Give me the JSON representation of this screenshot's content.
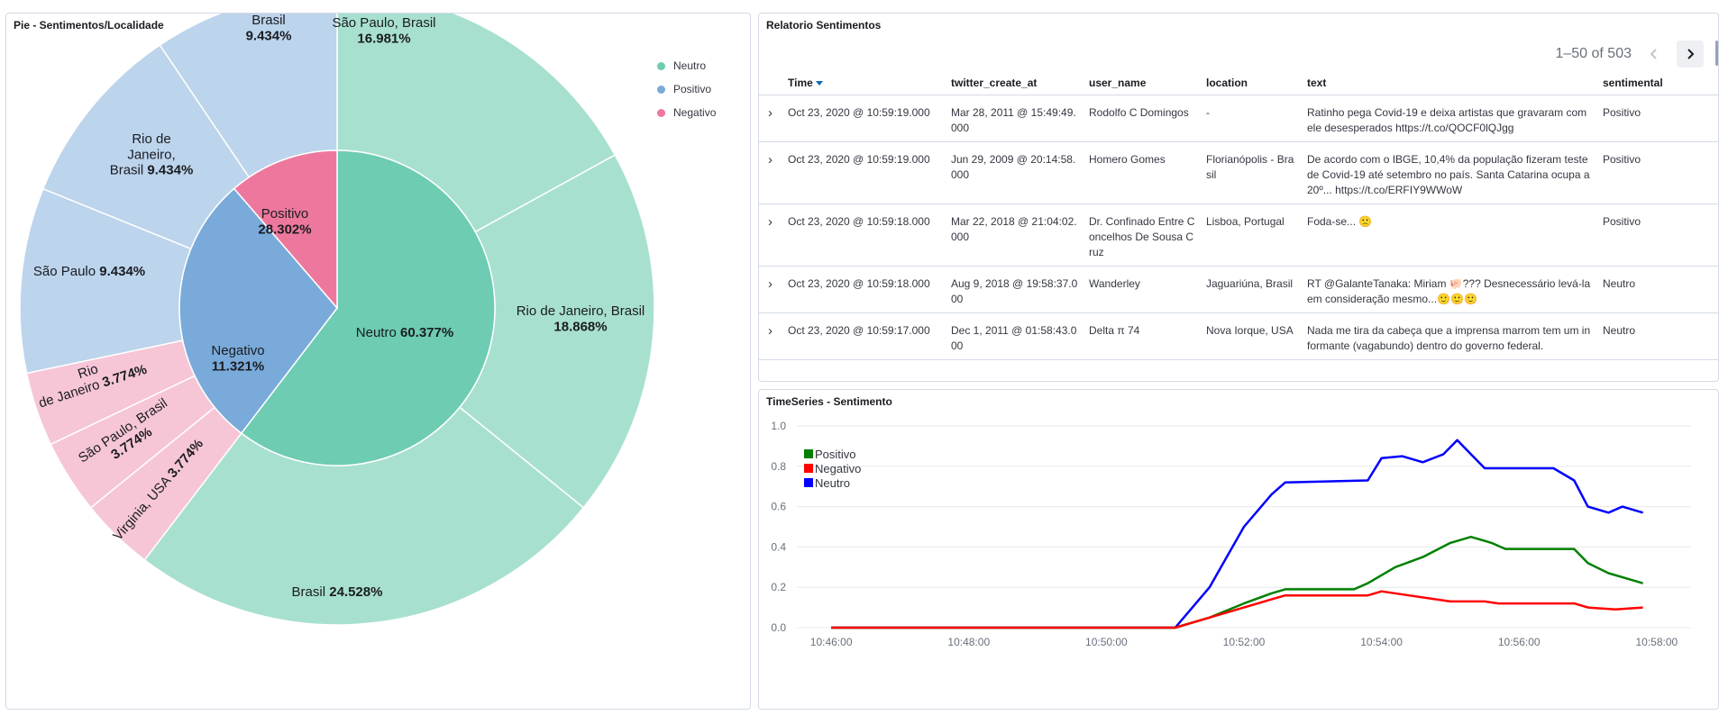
{
  "pie_panel": {
    "title": "Pie - Sentimentos/Localidade",
    "legend": [
      {
        "label": "Neutro",
        "color": "#6dccb1"
      },
      {
        "label": "Positivo",
        "color": "#79aad9"
      },
      {
        "label": "Negativo",
        "color": "#ee789d"
      }
    ]
  },
  "table_panel": {
    "title": "Relatorio Sentimentos",
    "pagination": {
      "text": "1–50 of 503",
      "prev_icon": "chevron-left-icon",
      "next_icon": "chevron-right-icon"
    },
    "columns": [
      "Time",
      "twitter_create_at",
      "user_name",
      "location",
      "text",
      "sentimental"
    ],
    "rows": [
      {
        "time": "Oct 23, 2020 @ 10:59:19.000",
        "created": "Mar 28, 2011 @ 15:49:49.000",
        "user": "Rodolfo C Domingos",
        "location": " -",
        "text": "Ratinho pega Covid-19 e deixa artistas que gravaram com ele desesperados https://t.co/QOCF0lQJgg",
        "sentimental": "Positivo"
      },
      {
        "time": "Oct 23, 2020 @ 10:59:19.000",
        "created": "Jun 29, 2009 @ 20:14:58.000",
        "user": "Homero Gomes",
        "location": "Florianópolis - Brasil",
        "text": "De acordo com o IBGE, 10,4% da população fizeram teste de Covid-19 até setembro no país. Santa Catarina ocupa a 20º... https://t.co/ERFIY9WWoW",
        "sentimental": "Positivo"
      },
      {
        "time": "Oct 23, 2020 @ 10:59:18.000",
        "created": "Mar 22, 2018 @ 21:04:02.000",
        "user": "Dr. Confinado Entre Concelhos De Sousa Cruz",
        "location": "Lisboa, Portugal",
        "text": "Foda-se... 🙁",
        "sentimental": "Positivo"
      },
      {
        "time": "Oct 23, 2020 @ 10:59:18.000",
        "created": "Aug 9, 2018 @ 19:58:37.000",
        "user": "Wanderley",
        "location": "Jaguariúna, Brasil",
        "text": "RT @GalanteTanaka: Miriam 🐖??? Desnecessário levá-la em consideração mesmo...🙂🙂🙂",
        "sentimental": "Neutro"
      },
      {
        "time": "Oct 23, 2020 @ 10:59:17.000",
        "created": "Dec 1, 2011 @ 01:58:43.000",
        "user": "Delta π 74",
        "location": "Nova Iorque, USA",
        "text": "Nada me tira da cabeça que a imprensa marrom tem um informante (vagabundo) dentro do governo federal.",
        "sentimental": "Neutro"
      }
    ]
  },
  "ts_panel": {
    "title": "TimeSeries - Sentimento",
    "legend": [
      {
        "label": "Positivo",
        "color": "#008000"
      },
      {
        "label": "Negativo",
        "color": "#ff0000"
      },
      {
        "label": "Neutro",
        "color": "#0000ff"
      }
    ]
  },
  "chart_data": [
    {
      "type": "pie",
      "title": "Pie - Sentimentos/Localidade",
      "inner_ring": [
        {
          "label": "Neutro",
          "value": 60.377,
          "display": "60.377%",
          "color": "#6dccb1"
        },
        {
          "label": "Positivo",
          "value": 28.302,
          "display": "28.302%",
          "color": "#79aad9"
        },
        {
          "label": "Negativo",
          "value": 11.321,
          "display": "11.321%",
          "color": "#ee789d"
        }
      ],
      "outer_ring": [
        {
          "parent": "Neutro",
          "label": "São Paulo, Brasil",
          "value": 16.981,
          "display": "16.981%"
        },
        {
          "parent": "Neutro",
          "label": "Rio de Janeiro, Brasil",
          "value": 18.868,
          "display": "18.868%"
        },
        {
          "parent": "Neutro",
          "label": "Brasil",
          "value": 24.528,
          "display": "24.528%"
        },
        {
          "parent": "Negativo",
          "label": "Virginia, USA",
          "value": 3.774,
          "display": "3.774%"
        },
        {
          "parent": "Negativo",
          "label": "São Paulo, Brasil",
          "value": 3.774,
          "display": "3.774%"
        },
        {
          "parent": "Negativo",
          "label": "Rio de Janeiro",
          "value": 3.774,
          "display": "3.774%"
        },
        {
          "parent": "Positivo",
          "label": "São Paulo",
          "value": 9.434,
          "display": "9.434%"
        },
        {
          "parent": "Positivo",
          "label": "Rio de Janeiro, Brasil",
          "value": 9.434,
          "display": "9.434%"
        },
        {
          "parent": "Positivo",
          "label": "Brasil",
          "value": 9.434,
          "display": "9.434%"
        }
      ],
      "outer_colors": {
        "Neutro": "#a8e0d0",
        "Positivo": "#bcd4ec",
        "Negativo": "#f6c6d6"
      }
    },
    {
      "type": "line",
      "title": "TimeSeries - Sentimento",
      "x_ticks": [
        "10:46:00",
        "10:48:00",
        "10:50:00",
        "10:52:00",
        "10:54:00",
        "10:56:00",
        "10:58:00"
      ],
      "y_ticks": [
        "0.0",
        "0.2",
        "0.4",
        "0.6",
        "0.8",
        "1.0"
      ],
      "xlim_minutes": [
        45.5,
        58.5
      ],
      "ylim": [
        0,
        1.0
      ],
      "series": [
        {
          "name": "Neutro",
          "color": "#0000ff",
          "points": [
            [
              46.0,
              0
            ],
            [
              51.0,
              0
            ],
            [
              51.2,
              0.08
            ],
            [
              51.5,
              0.2
            ],
            [
              51.8,
              0.38
            ],
            [
              52.0,
              0.5
            ],
            [
              52.2,
              0.58
            ],
            [
              52.4,
              0.66
            ],
            [
              52.6,
              0.72
            ],
            [
              53.8,
              0.73
            ],
            [
              54.0,
              0.84
            ],
            [
              54.3,
              0.85
            ],
            [
              54.6,
              0.82
            ],
            [
              54.9,
              0.86
            ],
            [
              55.1,
              0.93
            ],
            [
              55.3,
              0.86
            ],
            [
              55.5,
              0.79
            ],
            [
              56.5,
              0.79
            ],
            [
              56.8,
              0.73
            ],
            [
              57.0,
              0.6
            ],
            [
              57.3,
              0.57
            ],
            [
              57.5,
              0.6
            ],
            [
              57.8,
              0.57
            ]
          ]
        },
        {
          "name": "Positivo",
          "color": "#008000",
          "points": [
            [
              46.0,
              0
            ],
            [
              51.0,
              0
            ],
            [
              51.5,
              0.05
            ],
            [
              52.0,
              0.12
            ],
            [
              52.4,
              0.17
            ],
            [
              52.6,
              0.19
            ],
            [
              53.6,
              0.19
            ],
            [
              53.8,
              0.22
            ],
            [
              54.2,
              0.3
            ],
            [
              54.6,
              0.35
            ],
            [
              55.0,
              0.42
            ],
            [
              55.3,
              0.45
            ],
            [
              55.6,
              0.42
            ],
            [
              55.8,
              0.39
            ],
            [
              56.8,
              0.39
            ],
            [
              57.0,
              0.32
            ],
            [
              57.3,
              0.27
            ],
            [
              57.6,
              0.24
            ],
            [
              57.8,
              0.22
            ]
          ]
        },
        {
          "name": "Negativo",
          "color": "#ff0000",
          "points": [
            [
              46.0,
              0
            ],
            [
              51.0,
              0
            ],
            [
              51.5,
              0.05
            ],
            [
              52.0,
              0.1
            ],
            [
              52.4,
              0.14
            ],
            [
              52.6,
              0.16
            ],
            [
              53.8,
              0.16
            ],
            [
              54.0,
              0.18
            ],
            [
              54.4,
              0.16
            ],
            [
              55.0,
              0.13
            ],
            [
              55.5,
              0.13
            ],
            [
              55.7,
              0.12
            ],
            [
              56.8,
              0.12
            ],
            [
              57.0,
              0.1
            ],
            [
              57.4,
              0.09
            ],
            [
              57.8,
              0.1
            ]
          ]
        }
      ]
    }
  ]
}
